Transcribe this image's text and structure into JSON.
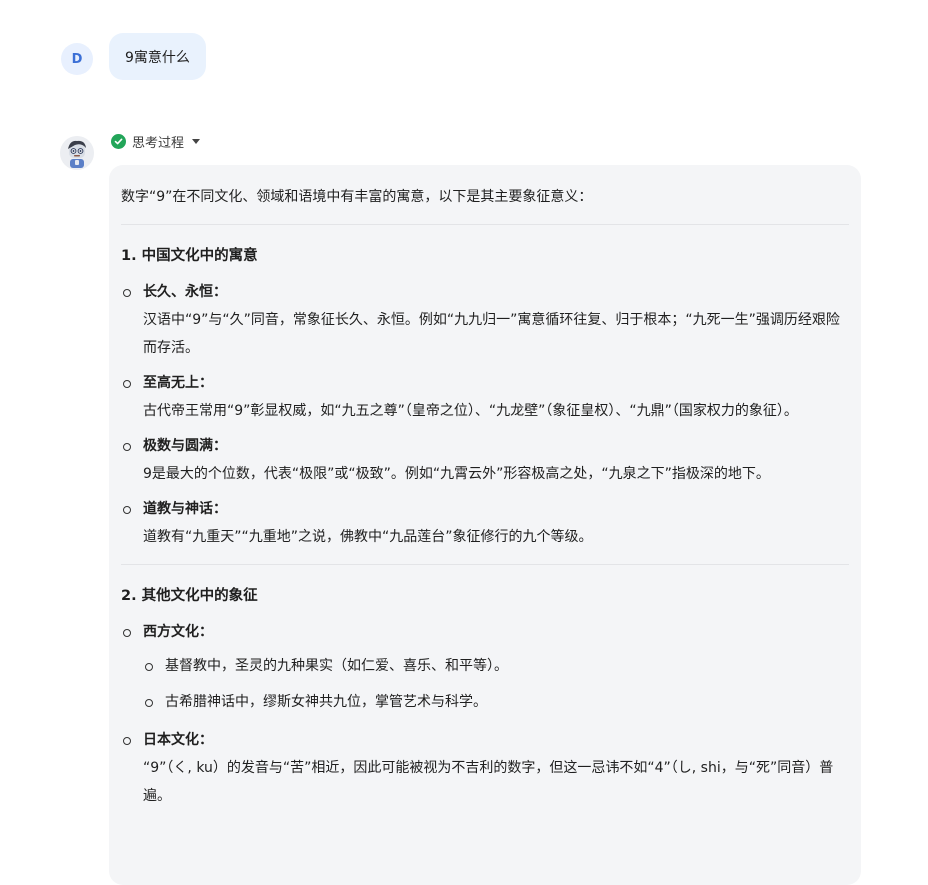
{
  "user": {
    "avatar_letter": "D",
    "message": "9寓意什么"
  },
  "assistant": {
    "thinking_label": "思考过程",
    "intro": "数字“9”在不同文化、领域和语境中有丰富的寓意，以下是其主要象征意义：",
    "sections": [
      {
        "title": "1. 中国文化中的寓意",
        "items": [
          {
            "head": "长久、永恒：",
            "body": "汉语中“9”与“久”同音，常象征长久、永恒。例如“九九归一”寓意循环往复、归于根本；“九死一生”强调历经艰险而存活。"
          },
          {
            "head": "至高无上：",
            "body": "古代帝王常用“9”彰显权威，如“九五之尊”（皇帝之位）、“九龙壁”（象征皇权）、“九鼎”（国家权力的象征）。"
          },
          {
            "head": "极数与圆满：",
            "body": "9是最大的个位数，代表“极限”或“极致”。例如“九霄云外”形容极高之处，“九泉之下”指极深的地下。"
          },
          {
            "head": "道教与神话：",
            "body": "道教有“九重天”“九重地”之说，佛教中“九品莲台”象征修行的九个等级。"
          }
        ]
      },
      {
        "title": "2. 其他文化中的象征",
        "items": [
          {
            "head": "西方文化：",
            "subitems": [
              "基督教中，圣灵的九种果实（如仁爱、喜乐、和平等）。",
              "古希腊神话中，缪斯女神共九位，掌管艺术与科学。"
            ]
          },
          {
            "head": "日本文化：",
            "body": "“9”（く, ku）的发音与“苦”相近，因此可能被视为不吉利的数字，但这一忌讳不如“4”（し, shi，与“死”同音）普遍。"
          }
        ]
      }
    ]
  }
}
